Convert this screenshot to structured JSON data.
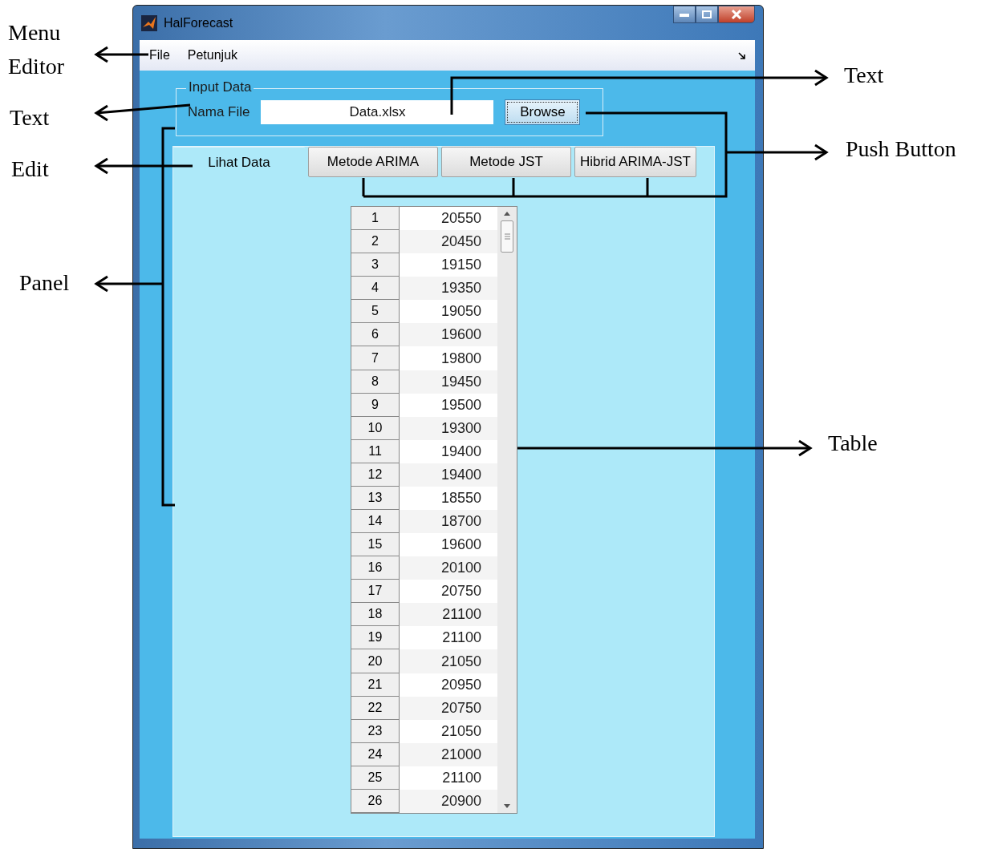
{
  "window": {
    "title": "HalForecast"
  },
  "menu": [
    {
      "label": "File"
    },
    {
      "label": "Petunjuk"
    }
  ],
  "input_panel": {
    "title": "Input Data",
    "label": "Nama File",
    "field_value": "Data.xlsx",
    "button": "Browse"
  },
  "tabs": [
    {
      "label": "Lihat Data",
      "selected": true
    },
    {
      "label": "Metode ARIMA",
      "selected": false
    },
    {
      "label": "Metode JST",
      "selected": false
    },
    {
      "label": "Hibrid ARIMA-JST",
      "selected": false
    }
  ],
  "table": {
    "rows": [
      {
        "index": "1",
        "value": "20550"
      },
      {
        "index": "2",
        "value": "20450"
      },
      {
        "index": "3",
        "value": "19150"
      },
      {
        "index": "4",
        "value": "19350"
      },
      {
        "index": "5",
        "value": "19050"
      },
      {
        "index": "6",
        "value": "19600"
      },
      {
        "index": "7",
        "value": "19800"
      },
      {
        "index": "8",
        "value": "19450"
      },
      {
        "index": "9",
        "value": "19500"
      },
      {
        "index": "10",
        "value": "19300"
      },
      {
        "index": "11",
        "value": "19400"
      },
      {
        "index": "12",
        "value": "19400"
      },
      {
        "index": "13",
        "value": "18550"
      },
      {
        "index": "14",
        "value": "18700"
      },
      {
        "index": "15",
        "value": "19600"
      },
      {
        "index": "16",
        "value": "20100"
      },
      {
        "index": "17",
        "value": "20750"
      },
      {
        "index": "18",
        "value": "21100"
      },
      {
        "index": "19",
        "value": "21100"
      },
      {
        "index": "20",
        "value": "21050"
      },
      {
        "index": "21",
        "value": "20950"
      },
      {
        "index": "22",
        "value": "20750"
      },
      {
        "index": "23",
        "value": "21050"
      },
      {
        "index": "24",
        "value": "21000"
      },
      {
        "index": "25",
        "value": "21100"
      },
      {
        "index": "26",
        "value": "20900"
      }
    ]
  },
  "annotations": [
    {
      "label": "Menu Editor"
    },
    {
      "label": "Text"
    },
    {
      "label": "Edit"
    },
    {
      "label": "Panel"
    },
    {
      "label": "Text"
    },
    {
      "label": "Push Button"
    },
    {
      "label": "Table"
    }
  ]
}
